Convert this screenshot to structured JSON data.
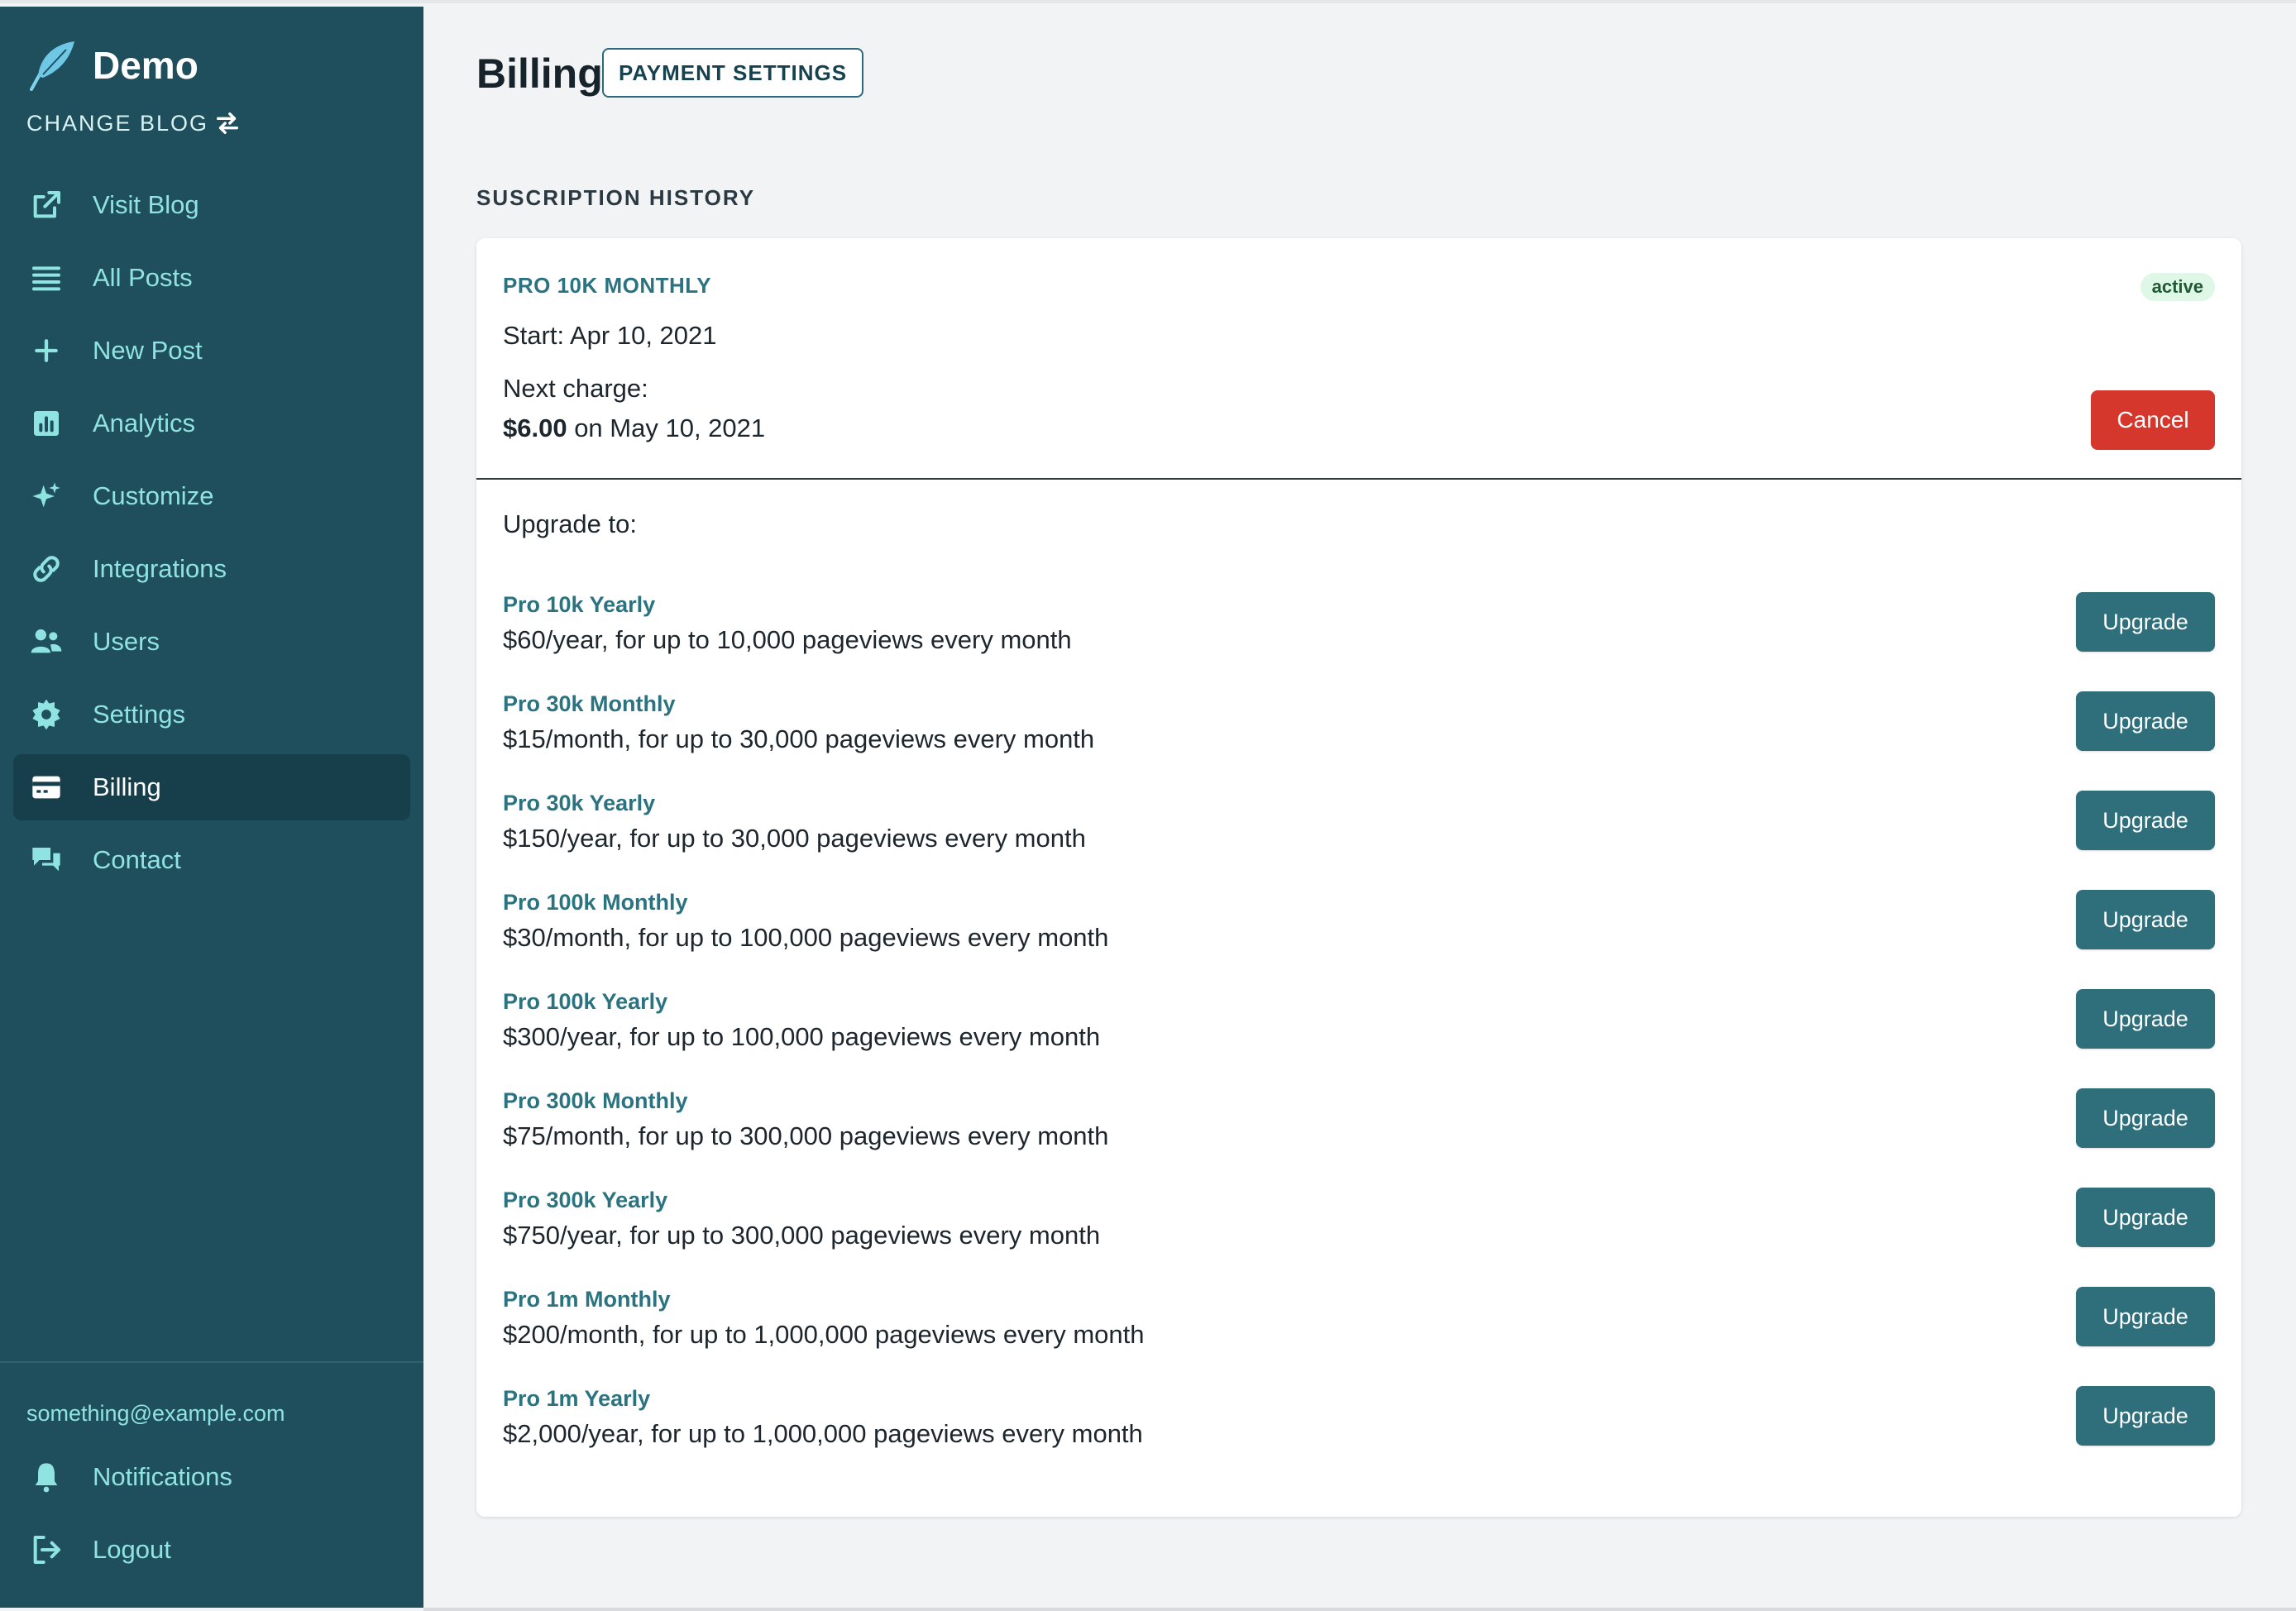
{
  "sidebar": {
    "brand": "Demo",
    "change_blog": "CHANGE BLOG",
    "items": [
      {
        "label": "Visit Blog",
        "icon": "external-link-icon"
      },
      {
        "label": "All Posts",
        "icon": "list-icon"
      },
      {
        "label": "New Post",
        "icon": "plus-icon"
      },
      {
        "label": "Analytics",
        "icon": "chart-icon"
      },
      {
        "label": "Customize",
        "icon": "sparkles-icon"
      },
      {
        "label": "Integrations",
        "icon": "link-icon"
      },
      {
        "label": "Users",
        "icon": "users-icon"
      },
      {
        "label": "Settings",
        "icon": "gear-icon"
      },
      {
        "label": "Billing",
        "icon": "credit-card-icon",
        "active": true
      },
      {
        "label": "Contact",
        "icon": "chat-icon"
      }
    ],
    "email": "something@example.com",
    "notifications": "Notifications",
    "logout": "Logout"
  },
  "header": {
    "title": "Billing",
    "payment_settings": "PAYMENT SETTINGS"
  },
  "history": {
    "heading": "SUSCRIPTION HISTORY",
    "plan": "PRO 10K MONTHLY",
    "status": "active",
    "start": "Start: Apr 10, 2021",
    "next_label": "Next charge:",
    "next_amount": "$6.00",
    "next_date": " on May 10, 2021",
    "cancel": "Cancel",
    "upgrade_to": "Upgrade to:",
    "upgrade_button": "Upgrade",
    "plans": [
      {
        "name": "Pro 10k Yearly",
        "desc": "$60/year, for up to 10,000 pageviews every month"
      },
      {
        "name": "Pro 30k Monthly",
        "desc": "$15/month, for up to 30,000 pageviews every month"
      },
      {
        "name": "Pro 30k Yearly",
        "desc": "$150/year, for up to 30,000 pageviews every month"
      },
      {
        "name": "Pro 100k Monthly",
        "desc": "$30/month, for up to 100,000 pageviews every month"
      },
      {
        "name": "Pro 100k Yearly",
        "desc": "$300/year, for up to 100,000 pageviews every month"
      },
      {
        "name": "Pro 300k Monthly",
        "desc": "$75/month, for up to 300,000 pageviews every month"
      },
      {
        "name": "Pro 300k Yearly",
        "desc": "$750/year, for up to 300,000 pageviews every month"
      },
      {
        "name": "Pro 1m Monthly",
        "desc": "$200/month, for up to 1,000,000 pageviews every month"
      },
      {
        "name": "Pro 1m Yearly",
        "desc": "$2,000/year, for up to 1,000,000 pageviews every month"
      }
    ]
  },
  "colors": {
    "sidebar_bg": "#1f4e5c",
    "accent": "#2b7381",
    "button": "#2f6f7c",
    "danger": "#d6372c",
    "badge_bg": "#dff7e6"
  }
}
